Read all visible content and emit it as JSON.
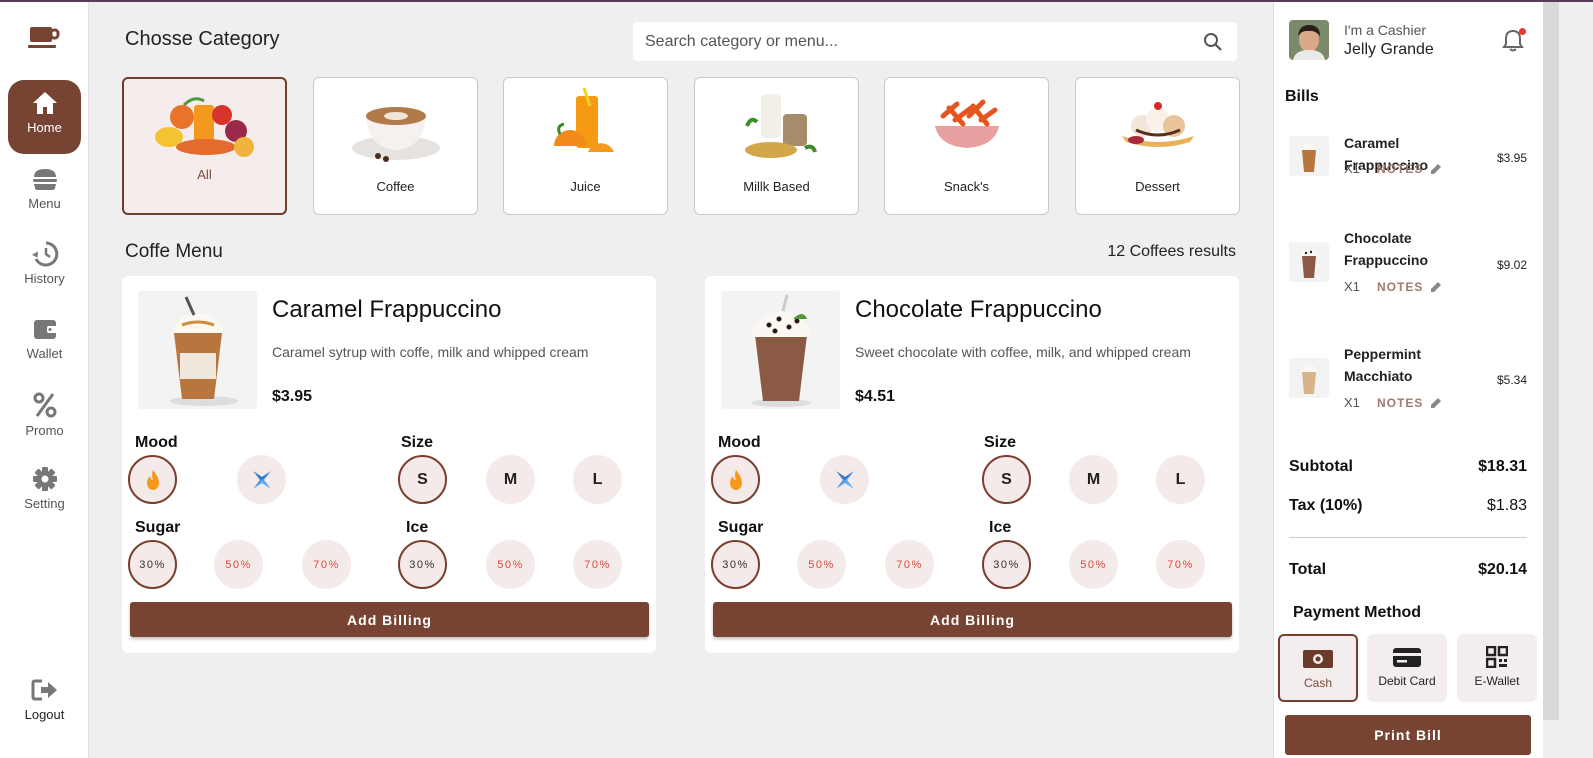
{
  "sidebar": {
    "items": [
      {
        "label": "Home",
        "icon": "home-icon"
      },
      {
        "label": "Menu",
        "icon": "burger-icon"
      },
      {
        "label": "History",
        "icon": "history-icon"
      },
      {
        "label": "Wallet",
        "icon": "wallet-icon"
      },
      {
        "label": "Promo",
        "icon": "percent-icon"
      },
      {
        "label": "Setting",
        "icon": "gear-icon"
      }
    ],
    "logout_label": "Logout",
    "active": "Home"
  },
  "header": {
    "title": "Chosse Category",
    "search_placeholder": "Search category or menu..."
  },
  "categories": [
    {
      "name": "All",
      "active": true
    },
    {
      "name": "Coffee"
    },
    {
      "name": "Juice"
    },
    {
      "name": "Millk Based"
    },
    {
      "name": "Snack's"
    },
    {
      "name": "Dessert"
    }
  ],
  "menu": {
    "title": "Coffe Menu",
    "results": "12 Coffees results",
    "option_labels": {
      "mood": "Mood",
      "size": "Size",
      "sugar": "Sugar",
      "ice": "Ice"
    },
    "sizes": [
      "S",
      "M",
      "L"
    ],
    "percents": [
      "30%",
      "50%",
      "70%"
    ],
    "add_label": "Add Billing",
    "products": [
      {
        "name": "Caramel Frappuccino",
        "desc": "Caramel sytrup with coffe, milk and whipped cream",
        "price": "$3.95"
      },
      {
        "name": "Chocolate Frappuccino",
        "desc": "Sweet chocolate with coffee, milk, and whipped cream",
        "price": "$4.51"
      }
    ]
  },
  "user": {
    "role": "I'm a Cashier",
    "name": "Jelly Grande"
  },
  "bills": {
    "title": "Bills",
    "notes_label": "NOTES",
    "items": [
      {
        "name": "Caramel Frappuccino",
        "qty": "X1",
        "price": "$3.95"
      },
      {
        "name": "Chocolate Frappuccino",
        "qty": "X1",
        "price": "$9.02"
      },
      {
        "name": "Peppermint Macchiato",
        "qty": "X1",
        "price": "$5.34"
      }
    ],
    "subtotal_label": "Subtotal",
    "subtotal": "$18.31",
    "tax_label": "Tax (10%)",
    "tax": "$1.83",
    "total_label": "Total",
    "total": "$20.14"
  },
  "payment": {
    "title": "Payment Method",
    "methods": [
      "Cash",
      "Debit Card",
      "E-Wallet"
    ],
    "selected": "Cash",
    "print_label": "Print Bill"
  },
  "colors": {
    "accent": "#774434",
    "active_bg": "#f5ecec",
    "percent_text": "#e04a3a"
  }
}
